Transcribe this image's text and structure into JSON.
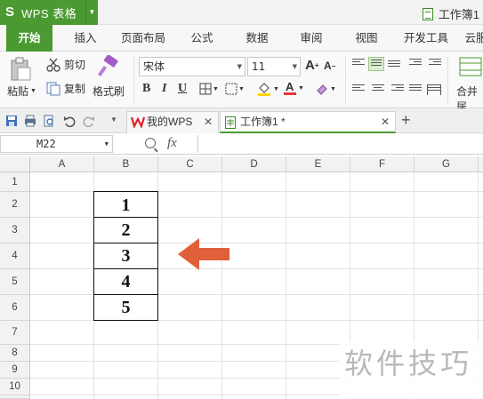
{
  "app": {
    "name": "WPS 表格",
    "document_title": "工作簿1",
    "brand_color": "#4a9a31"
  },
  "ribbon_tabs": [
    "开始",
    "插入",
    "页面布局",
    "公式",
    "数据",
    "审阅",
    "视图",
    "开发工具",
    "云服"
  ],
  "active_tab": "开始",
  "ribbon": {
    "paste_label": "粘贴",
    "cut_label": "剪切",
    "copy_label": "复制",
    "format_painter_label": "格式刷",
    "font_name": "宋体",
    "font_size": "11",
    "merge_label": "合并居",
    "bold": "B",
    "italic": "I",
    "underline": "U",
    "font_color": "#e53935",
    "fill_color": "#ffd600"
  },
  "doc_tabs": [
    {
      "label": "我的WPS",
      "active": false
    },
    {
      "label": "工作簿1 *",
      "active": true
    }
  ],
  "formula_bar": {
    "name_box": "M22",
    "fx": "fx",
    "formula": ""
  },
  "grid": {
    "columns": [
      "A",
      "B",
      "C",
      "D",
      "E",
      "F",
      "G"
    ],
    "rows": [
      "1",
      "2",
      "3",
      "4",
      "5",
      "6",
      "7",
      "8",
      "9",
      "10"
    ],
    "cells": [
      {
        "ref": "B2",
        "value": "1"
      },
      {
        "ref": "B3",
        "value": "2"
      },
      {
        "ref": "B4",
        "value": "3"
      },
      {
        "ref": "B5",
        "value": "4"
      },
      {
        "ref": "B6",
        "value": "5"
      }
    ]
  },
  "annotation": {
    "arrow_color": "#e0603a",
    "arrow_direction": "left"
  },
  "watermark": "软件技巧",
  "icons": [
    "paste-icon",
    "scissors-icon",
    "copy-icon",
    "format-painter-icon",
    "increase-font-icon",
    "decrease-font-icon",
    "border-icon",
    "fill-color-icon",
    "font-color-icon",
    "clear-format-icon",
    "align-icons",
    "merge-center-icon",
    "save-icon",
    "print-icon",
    "print-preview-icon",
    "undo-icon",
    "redo-icon",
    "wps-logo-icon",
    "document-icon",
    "zoom-icon"
  ]
}
